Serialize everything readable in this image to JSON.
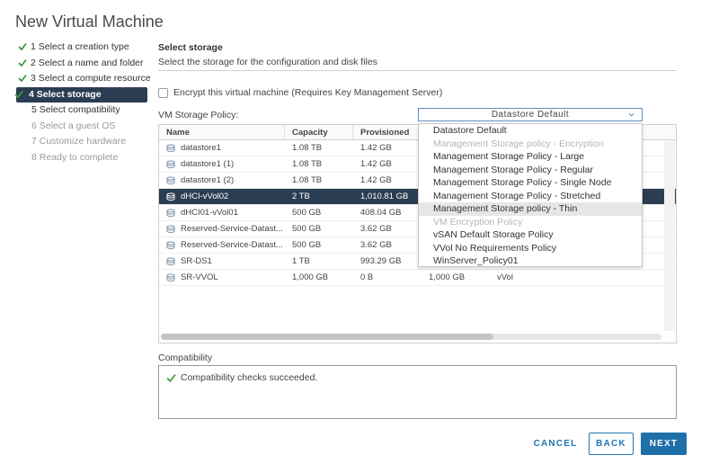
{
  "title": "New Virtual Machine",
  "steps": [
    {
      "label": "1 Select a creation type",
      "state": "done"
    },
    {
      "label": "2 Select a name and folder",
      "state": "done"
    },
    {
      "label": "3 Select a compute resource",
      "state": "done"
    },
    {
      "label": "4 Select storage",
      "state": "active"
    },
    {
      "label": "5 Select compatibility",
      "state": "enabled"
    },
    {
      "label": "6 Select a guest OS",
      "state": "disabled"
    },
    {
      "label": "7 Customize hardware",
      "state": "disabled"
    },
    {
      "label": "8 Ready to complete",
      "state": "disabled"
    }
  ],
  "section": {
    "title": "Select storage",
    "description": "Select the storage for the configuration and disk files"
  },
  "encrypt_label": "Encrypt this virtual machine (Requires Key Management Server)",
  "policy_label": "VM Storage Policy:",
  "policy_selected": "Datastore Default",
  "policy_options": [
    {
      "label": "Datastore Default",
      "disabled": false
    },
    {
      "label": "Management Storage policy - Encryption",
      "disabled": true
    },
    {
      "label": "Management Storage Policy - Large",
      "disabled": false
    },
    {
      "label": "Management Storage Policy - Regular",
      "disabled": false
    },
    {
      "label": "Management Storage Policy - Single Node",
      "disabled": false
    },
    {
      "label": "Management Storage Policy - Stretched",
      "disabled": false
    },
    {
      "label": "Management Storage policy - Thin",
      "disabled": false,
      "hover": true
    },
    {
      "label": "VM Encryption Policy",
      "disabled": true
    },
    {
      "label": "vSAN Default Storage Policy",
      "disabled": false
    },
    {
      "label": "VVol No Requirements Policy",
      "disabled": false
    },
    {
      "label": "WinServer_Policy01",
      "disabled": false
    }
  ],
  "table": {
    "columns": [
      "Name",
      "Capacity",
      "Provisioned"
    ],
    "rows": [
      {
        "name": "datastore1",
        "capacity": "1.08 TB",
        "provisioned": "1.42 GB",
        "free": "",
        "type": ""
      },
      {
        "name": "datastore1 (1)",
        "capacity": "1.08 TB",
        "provisioned": "1.42 GB",
        "free": "",
        "type": ""
      },
      {
        "name": "datastore1 (2)",
        "capacity": "1.08 TB",
        "provisioned": "1.42 GB",
        "free": "",
        "type": ""
      },
      {
        "name": "dHCI-vVol02",
        "capacity": "2 TB",
        "provisioned": "1,010.81 GB",
        "free": "",
        "type": "",
        "selected": true
      },
      {
        "name": "dHCI01-vVol01",
        "capacity": "500 GB",
        "provisioned": "408.04 GB",
        "free": "",
        "type": ""
      },
      {
        "name": "Reserved-Service-Datast...",
        "capacity": "500 GB",
        "provisioned": "3.62 GB",
        "free": "",
        "type": ""
      },
      {
        "name": "Reserved-Service-Datast...",
        "capacity": "500 GB",
        "provisioned": "3.62 GB",
        "free": "",
        "type": ""
      },
      {
        "name": "SR-DS1",
        "capacity": "1 TB",
        "provisioned": "993.29 GB",
        "free": "",
        "type": ""
      },
      {
        "name": "SR-VVOL",
        "capacity": "1,000 GB",
        "provisioned": "0 B",
        "free": "1,000 GB",
        "type": "vVol"
      }
    ]
  },
  "compatibility": {
    "label": "Compatibility",
    "message": "Compatibility checks succeeded."
  },
  "buttons": {
    "cancel": "CANCEL",
    "back": "BACK",
    "next": "NEXT"
  },
  "colors": {
    "selected_row": "#2b3d52",
    "primary": "#1f6fa8",
    "check_green": "#3b9c3f"
  }
}
